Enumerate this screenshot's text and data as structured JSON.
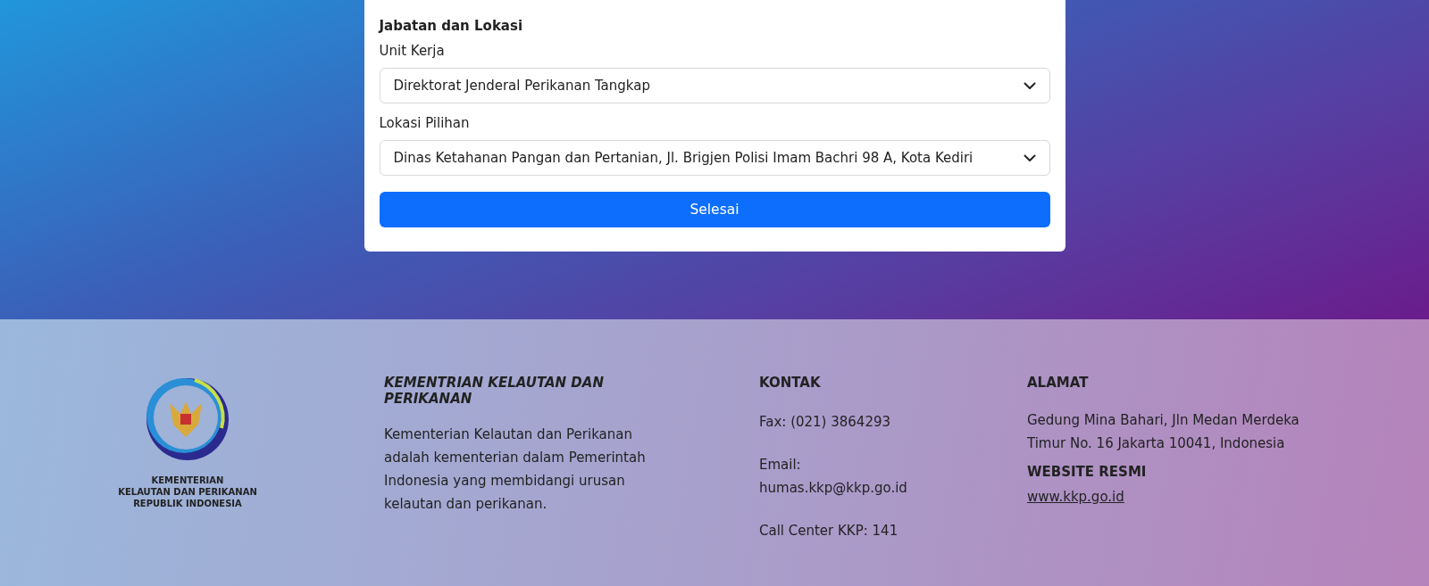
{
  "form": {
    "section_title": "Jabatan dan Lokasi",
    "fields": [
      {
        "label": "Unit Kerja",
        "value": "Direktorat Jenderal Perikanan Tangkap"
      },
      {
        "label": "Lokasi Pilihan",
        "value": "Dinas Ketahanan Pangan dan Pertanian, Jl. Brigjen Polisi Imam Bachri 98 A, Kota Kediri"
      }
    ],
    "submit_button": "Selesai"
  },
  "footer": {
    "logo_text": [
      "KEMENTERIAN",
      "KELAUTAN DAN PERIKANAN",
      "REPUBLIK INDONESIA"
    ],
    "about": {
      "title": "KEMENTRIAN KELAUTAN DAN PERIKANAN",
      "text": "Kementerian Kelautan dan Perikanan adalah kementerian dalam Pemerintah Indonesia yang membidangi urusan kelautan dan perikanan."
    },
    "contact": {
      "title": "KONTAK",
      "items": [
        "Fax: (021) 3864293",
        "Email: humas.kkp@kkp.go.id",
        "Call Center KKP: 141"
      ]
    },
    "address": {
      "title": "ALAMAT",
      "text": "Gedung Mina Bahari, Jln Medan Merdeka Timur No. 16 Jakarta 10041, Indonesia",
      "website_title": "WEBSITE RESMI",
      "website_link": "www.kkp.go.id"
    }
  }
}
